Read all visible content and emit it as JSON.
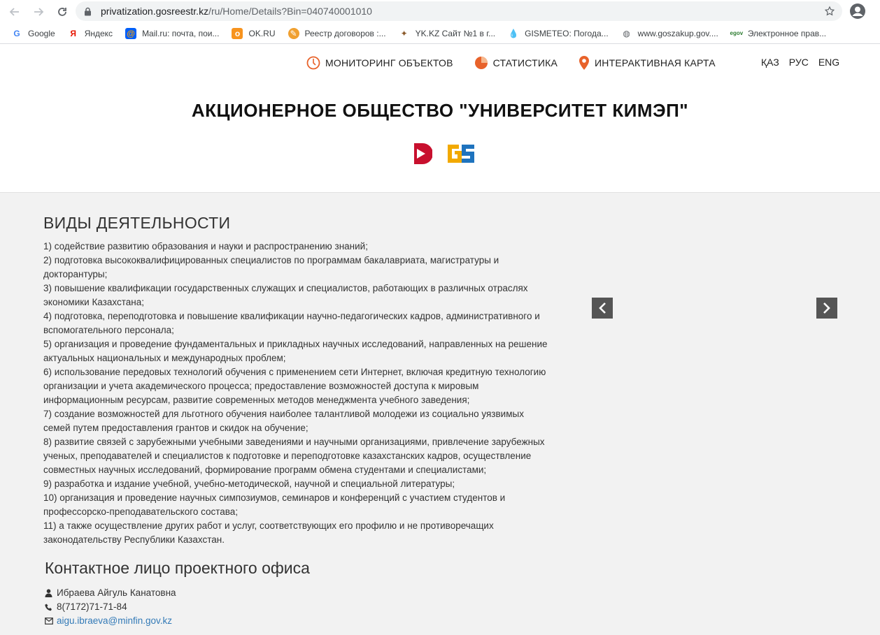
{
  "browser": {
    "url_host": "privatization.gosreestr.kz",
    "url_path": "/ru/Home/Details?Bin=040740001010",
    "bookmarks": [
      {
        "label": "Google",
        "icon": "google-icon"
      },
      {
        "label": "Яндекс",
        "icon": "yandex-icon"
      },
      {
        "label": "Mail.ru: почта, пои...",
        "icon": "mailru-icon"
      },
      {
        "label": "OK.RU",
        "icon": "ok-icon"
      },
      {
        "label": "Реестр договоров :...",
        "icon": "registry-icon"
      },
      {
        "label": "YK.KZ Сайт №1 в г...",
        "icon": "yk-icon"
      },
      {
        "label": "GISMETEO: Погода...",
        "icon": "gismeteo-icon"
      },
      {
        "label": "www.goszakup.gov....",
        "icon": "globe-icon"
      },
      {
        "label": "Электронное прав...",
        "icon": "egov-icon"
      }
    ]
  },
  "nav": {
    "monitoring": "МОНИТОРИНГ ОБЪЕКТОВ",
    "statistics": "СТАТИСТИКА",
    "map": "ИНТЕРАКТИВНАЯ КАРТА",
    "langs": [
      "ҚАЗ",
      "РУС",
      "ENG"
    ]
  },
  "org": {
    "title": "АКЦИОНЕРНОЕ ОБЩЕСТВО \"УНИВЕРСИТЕТ КИМЭП\""
  },
  "activities": {
    "heading": "ВИДЫ ДЕЯТЕЛЬНОСТИ",
    "lines": [
      "1) содействие развитию образования и науки и распространению знаний;",
      "2) подготовка высококвалифицированных специалистов по программам бакалавриата, магистратуры и",
      "докторантуры;",
      "3) повышение квалификации государственных служащих и специалистов, работающих в различных отраслях",
      "экономики Казахстана;",
      "4) подготовка, переподготовка и повышение квалификации научно-педагогических кадров, административного и",
      "вспомогательного персонала;",
      "5) организация и проведение фундаментальных и прикладных научных исследований, направленных на решение",
      "актуальных национальных и международных проблем;",
      "6) использование передовых технологий обучения с применением сети Интернет, включая кредитную технологию",
      "организации и учета академического процесса; предоставление возможностей доступа к мировым",
      "информационным ресурсам, развитие современных методов менеджмента учебного заведения;",
      "7) создание возможностей для льготного обучения наиболее талантливой молодежи из социально уязвимых",
      "семей путем предоставления грантов и скидок на обучение;",
      "8) развитие связей с зарубежными учебными заведениями и научными организациями, привлечение зарубежных",
      "ученых, преподавателей и специалистов к подготовке и переподготовке казахстанских кадров, осуществление",
      "совместных научных исследований, формирование программ обмена студентами и специалистами;",
      "9) разработка и издание учебной, учебно-методической, научной и специальной литературы;",
      "10) организация и проведение научных симпозиумов, семинаров и конференций с участием студентов и",
      "профессорско-преподавательского состава;",
      "11) а также осуществление других работ и услуг, соответствующих его профилю и не противоречащих",
      "законодательству Республики Казахстан."
    ]
  },
  "contact": {
    "heading": "Контактное лицо проектного офиса",
    "name": "Ибраева Айгуль Канатовна",
    "phone": "8(7172)71-71-84",
    "email": "aigu.ibraeva@minfin.gov.kz"
  },
  "colors": {
    "accent_orange": "#e8622a",
    "link": "#337ab7",
    "background": "#f2f2f2"
  }
}
